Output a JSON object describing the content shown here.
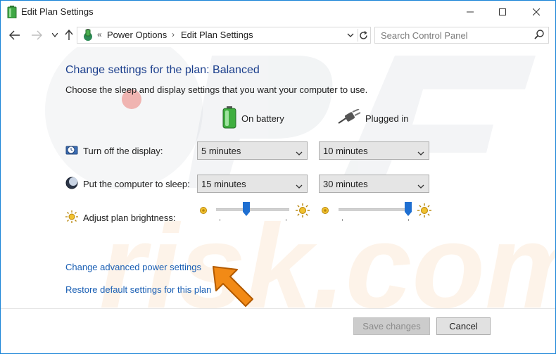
{
  "window": {
    "title": "Edit Plan Settings",
    "border_color": "#1883d7"
  },
  "address_bar": {
    "separator": "«",
    "crumbs": [
      "Power Options",
      "Edit Plan Settings"
    ],
    "crumb_separator": "›",
    "icon": "power-options-icon"
  },
  "search": {
    "placeholder": "Search Control Panel"
  },
  "main": {
    "heading": "Change settings for the plan: Balanced",
    "subtext": "Choose the sleep and display settings that you want your computer to use.",
    "columns": {
      "battery": "On battery",
      "plugged": "Plugged in"
    },
    "rows": {
      "display": {
        "label": "Turn off the display:",
        "battery": "5 minutes",
        "plugged": "10 minutes"
      },
      "sleep": {
        "label": "Put the computer to sleep:",
        "battery": "15 minutes",
        "plugged": "30 minutes"
      },
      "brightness": {
        "label": "Adjust plan brightness:",
        "battery_level": 0.4,
        "plugged_level": 1.0
      }
    },
    "links": {
      "advanced": "Change advanced power settings",
      "restore": "Restore default settings for this plan"
    }
  },
  "footer": {
    "save": "Save changes",
    "cancel": "Cancel"
  },
  "colors": {
    "heading": "#1a3e8c",
    "link": "#1a5fb4",
    "slider_thumb": "#1f6fd1",
    "arrow_annotation": "#f28a16"
  }
}
